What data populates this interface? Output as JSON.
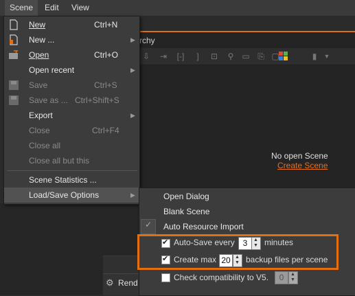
{
  "menubar": {
    "items": [
      {
        "label": "Scene",
        "active": true
      },
      {
        "label": "Edit",
        "active": false
      },
      {
        "label": "View",
        "active": false
      }
    ]
  },
  "panel": {
    "title_fragment": "rchy",
    "empty_message": "No open Scene",
    "create_link": "Create Scene",
    "bottom_tab_label": "Rend"
  },
  "scene_menu": {
    "items": [
      {
        "key": "new",
        "label": "New",
        "shortcut": "Ctrl+N",
        "enabled": true,
        "icon": "new-file-icon"
      },
      {
        "key": "new_from",
        "label": "New ...",
        "shortcut": "",
        "enabled": true,
        "submenu": true,
        "icon": "new-template-icon"
      },
      {
        "key": "open",
        "label": "Open",
        "shortcut": "Ctrl+O",
        "enabled": true,
        "icon": "open-folder-icon"
      },
      {
        "key": "open_recent",
        "label": "Open recent",
        "shortcut": "",
        "enabled": true,
        "submenu": true
      },
      {
        "key": "save",
        "label": "Save",
        "shortcut": "Ctrl+S",
        "enabled": false,
        "icon": "save-icon"
      },
      {
        "key": "save_as",
        "label": "Save as ...",
        "shortcut": "Ctrl+Shift+S",
        "enabled": false,
        "icon": "save-as-icon"
      },
      {
        "key": "export",
        "label": "Export",
        "shortcut": "",
        "enabled": true,
        "submenu": true
      },
      {
        "key": "close",
        "label": "Close",
        "shortcut": "Ctrl+F4",
        "enabled": false
      },
      {
        "key": "close_all",
        "label": "Close all",
        "shortcut": "",
        "enabled": false
      },
      {
        "key": "close_all_but",
        "label": "Close all but this",
        "shortcut": "",
        "enabled": false
      },
      {
        "key": "statistics",
        "label": "Scene Statistics ...",
        "shortcut": "",
        "enabled": true
      },
      {
        "key": "load_save",
        "label": "Load/Save Options",
        "shortcut": "",
        "enabled": true,
        "submenu": true,
        "highlighted": true
      }
    ]
  },
  "load_save_submenu": {
    "open_dialog": "Open Dialog",
    "blank_scene": "Blank Scene",
    "auto_resource_import": "Auto Resource Import",
    "auto_resource_import_checked": true,
    "autosave": {
      "label_before": "Auto-Save every",
      "value": "3",
      "label_after": "minutes",
      "checked": true
    },
    "backups": {
      "label_before": "Create max",
      "value": "20",
      "label_after": "backup files per scene",
      "checked": true
    },
    "compat": {
      "label": "Check compatibility to V5.",
      "value": "0",
      "checked": false
    }
  },
  "colors": {
    "accent": "#e36f0e",
    "link": "#e86f1c",
    "menu_bg": "#3c3c3c"
  }
}
